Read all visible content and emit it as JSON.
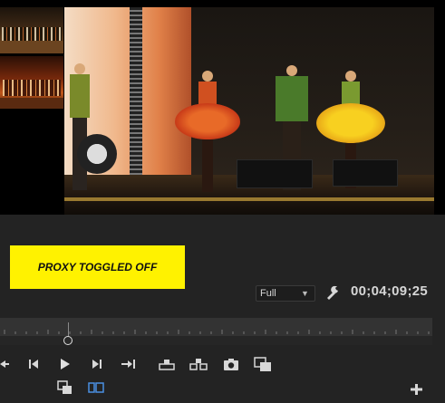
{
  "banner": {
    "text": "PROXY TOGGLED OFF",
    "background_color": "#fff200"
  },
  "monitor": {
    "playback_resolution": "Full",
    "timecode": "00;04;09;25"
  },
  "icons": {
    "settings": "wrench-icon",
    "transport": [
      "go-to-in-icon",
      "step-back-icon",
      "play-icon",
      "step-forward-icon",
      "go-to-out-icon",
      "lift-icon",
      "extract-icon",
      "export-frame-icon",
      "insert-clip-icon",
      "toggle-proxies-icon",
      "comparison-view-icon",
      "add-button-icon"
    ]
  },
  "colors": {
    "panel_background": "#232323",
    "accent_blue": "#4a90e2"
  }
}
